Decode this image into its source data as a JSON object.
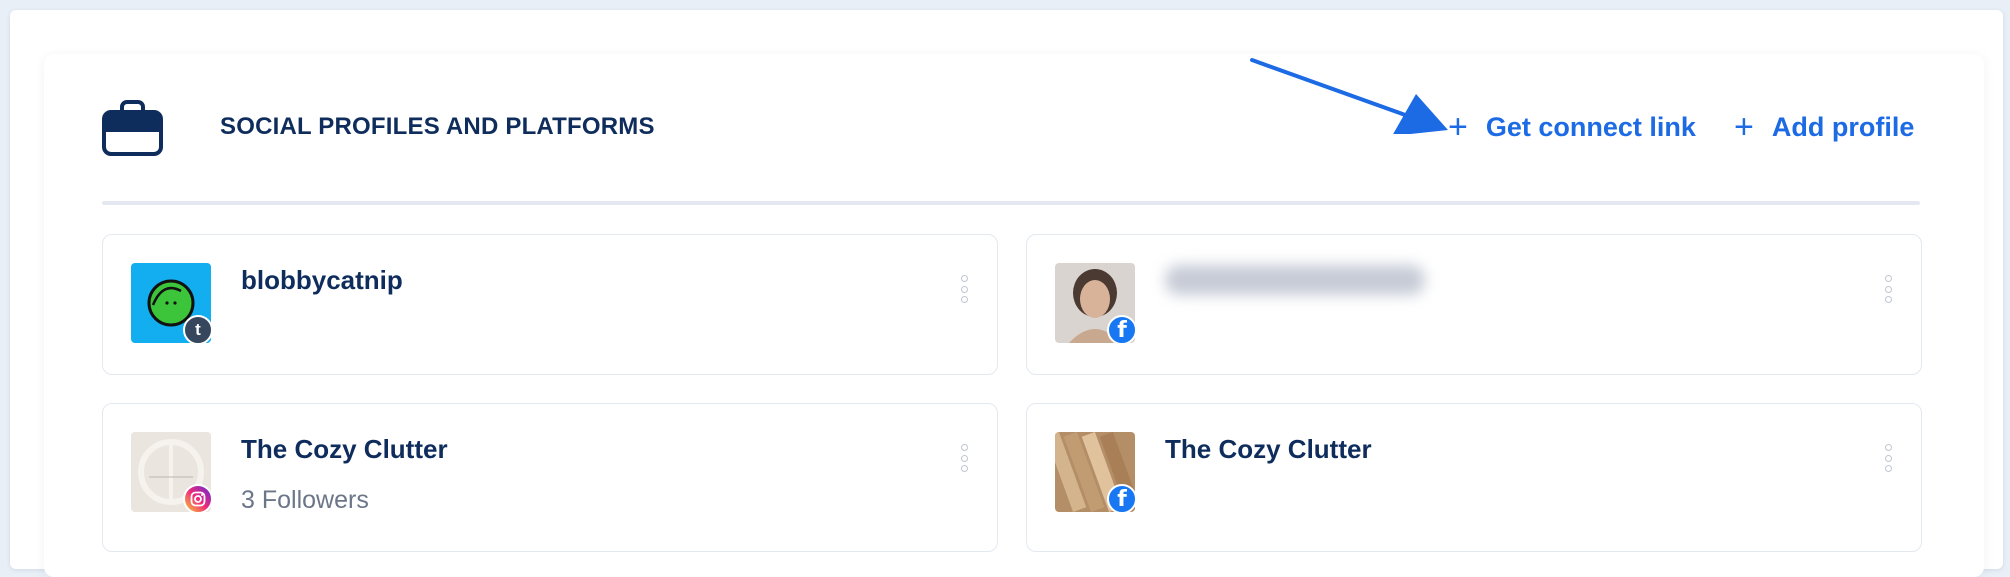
{
  "header": {
    "title": "SOCIAL PROFILES AND PLATFORMS",
    "icon": "briefcase-icon"
  },
  "actions": {
    "connect_link": "Get connect link",
    "add_profile": "Add profile",
    "plus_glyph": "+"
  },
  "colors": {
    "accent": "#1d6ae5",
    "title": "#0f2d5c",
    "muted": "#6b7689"
  },
  "profiles": [
    {
      "name": "blobbycatnip",
      "followers": "",
      "platform": "tumblr",
      "badge": "t"
    },
    {
      "name": "",
      "followers": "",
      "platform": "facebook",
      "badge": "f",
      "name_obscured": true
    },
    {
      "name": "The Cozy Clutter",
      "followers": "3 Followers",
      "platform": "instagram",
      "badge": ""
    },
    {
      "name": "The Cozy Clutter",
      "followers": "",
      "platform": "facebook",
      "badge": "f"
    }
  ]
}
